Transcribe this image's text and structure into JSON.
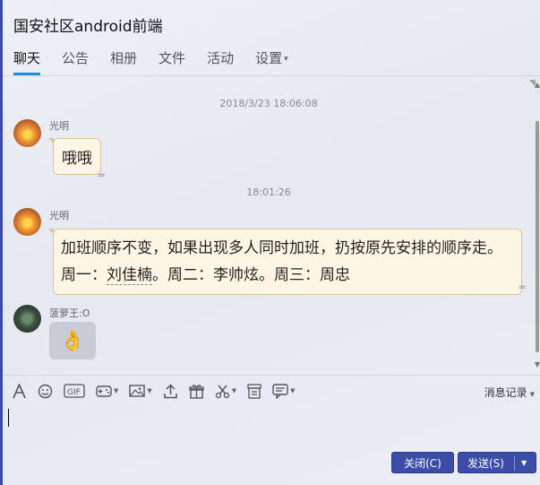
{
  "window": {
    "title": "国安社区android前端"
  },
  "tabs": [
    {
      "label": "聊天",
      "active": true
    },
    {
      "label": "公告"
    },
    {
      "label": "相册"
    },
    {
      "label": "文件"
    },
    {
      "label": "活动"
    },
    {
      "label": "设置",
      "dropdown": true
    }
  ],
  "messages": {
    "ts1": "2018/3/23 18:06:08",
    "m1": {
      "sender": "光明",
      "text": "哦哦"
    },
    "ts2": "18:01:26",
    "m2": {
      "sender": "光明",
      "text_before": "加班顺序不变，如果出现多人同时加班，扔按原先安排的顺序走。周一：",
      "link": "刘佳楠",
      "text_after": "。周二：李帅炫。周三：周忠"
    },
    "m3": {
      "sender": "菠萝王:O",
      "emoji": "👌"
    }
  },
  "toolbar": {
    "icons": [
      "font-icon",
      "emoji-icon",
      "gif-icon",
      "gamepad-icon",
      "image-icon",
      "upload-icon",
      "gift-icon",
      "scissors-icon",
      "archive-icon",
      "chat-bubble-icon"
    ],
    "history_label": "消息记录"
  },
  "buttons": {
    "close": "关闭(C)",
    "send": "发送(S)"
  },
  "colors": {
    "accent_blue": "#3c4da8",
    "tab_underline": "#1f8fd6",
    "bubble_bg": "#fdf6e4"
  }
}
